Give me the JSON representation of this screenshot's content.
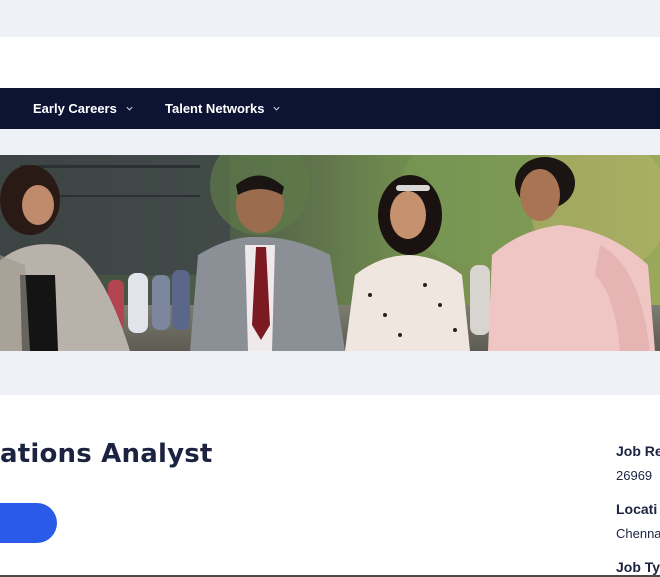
{
  "nav": {
    "items": [
      {
        "label": "Early Careers"
      },
      {
        "label": "Talent Networks"
      }
    ]
  },
  "hero": {
    "image": "group-of-four-professionals-walking-outdoors"
  },
  "job": {
    "title": "ations Analyst",
    "meta": [
      {
        "label": "Job Re",
        "value": "26969"
      },
      {
        "label": "Locati",
        "value": "Chenna"
      },
      {
        "label": "Job Ty",
        "value": ""
      }
    ]
  },
  "colors": {
    "nav_bg": "#0d1433",
    "accent": "#2a5be8",
    "text": "#1b2340",
    "page_bg": "#eef2f6"
  }
}
